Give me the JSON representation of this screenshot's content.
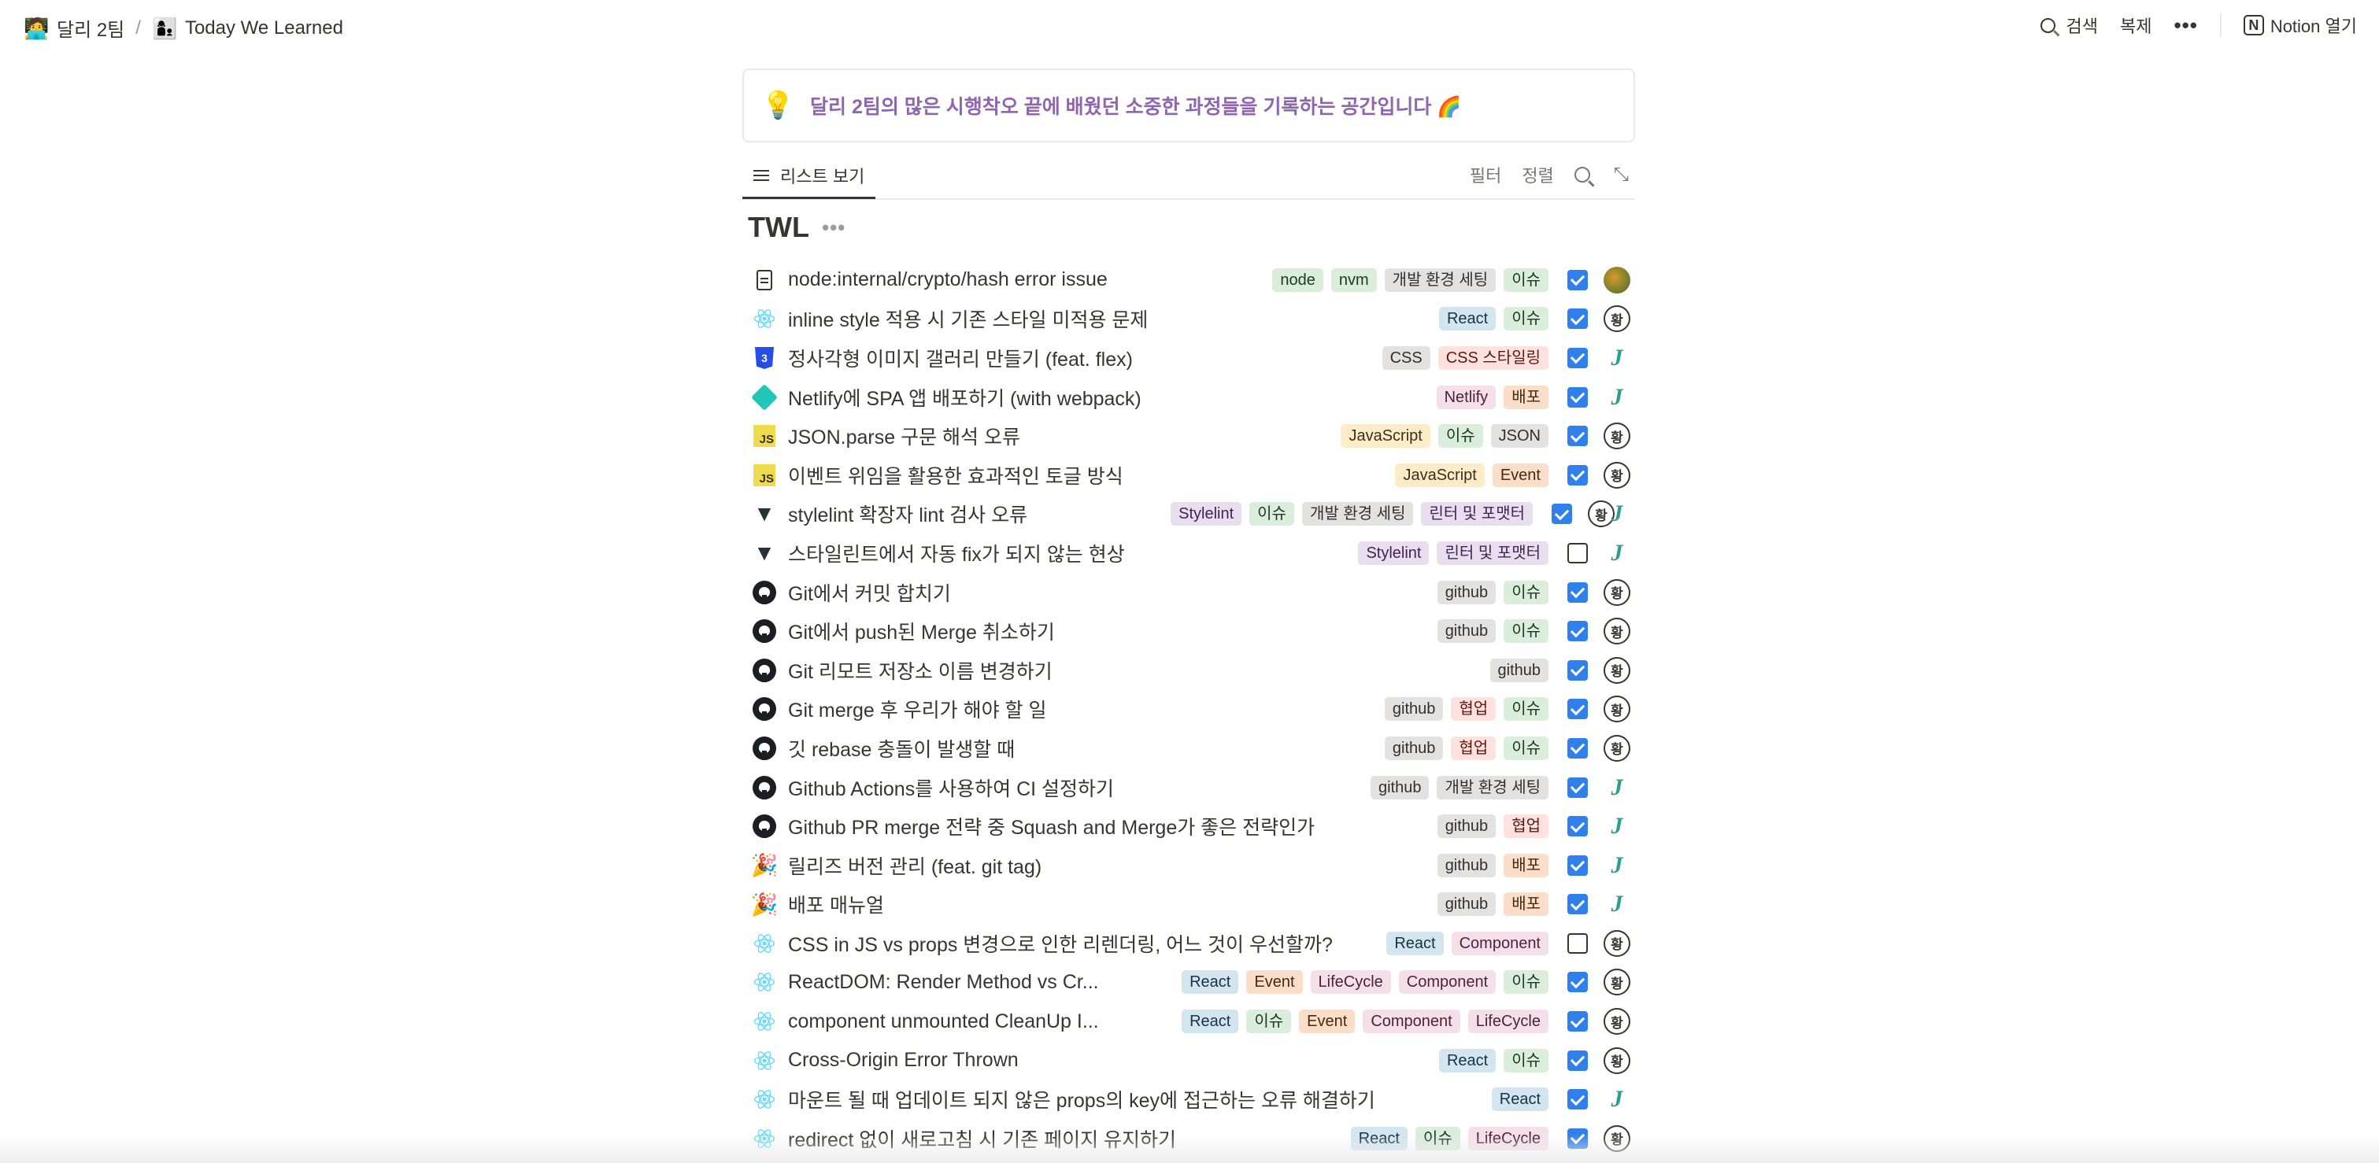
{
  "breadcrumb": {
    "items": [
      {
        "icon": "developer-emoji",
        "label": "달리 2팀"
      },
      {
        "icon": "people-emoji",
        "label": "Today We Learned"
      }
    ],
    "separator": "/"
  },
  "topbar": {
    "search_label": "검색",
    "duplicate_label": "복제",
    "more_label": "•••",
    "open_notion_label": "Notion 열기"
  },
  "callout": {
    "icon": "lightbulb-emoji",
    "text": "달리 2팀의 많은 시행착오 끝에 배웠던 소중한 과정들을 기록하는 공간입니다 🌈",
    "color": "#9065b0"
  },
  "view": {
    "tab_label": "리스트 보기",
    "filter_label": "필터",
    "sort_label": "정렬"
  },
  "database": {
    "title": "TWL",
    "more_label": "•••"
  },
  "colors": {
    "checkbox_checked": "#2f80ed",
    "tag_bg": {
      "gray": "#e3e2e0",
      "green": "#dbeddb",
      "blue": "#d3e5ef",
      "red": "#ffe2dd",
      "pink": "#f5e0e9",
      "orange": "#fadec9",
      "yellow": "#fdecc8",
      "purple": "#e8deee"
    },
    "tag_fg": {
      "gray": "#32302c",
      "green": "#1c3829",
      "blue": "#183347",
      "red": "#5d1715",
      "pink": "#4c2337",
      "orange": "#49290e",
      "yellow": "#402c1b",
      "purple": "#412454"
    }
  },
  "rows": [
    {
      "icon": "document-icon",
      "title": "node:internal/crypto/hash error issue",
      "tags": [
        {
          "label": "node",
          "color": "green"
        },
        {
          "label": "nvm",
          "color": "green"
        },
        {
          "label": "개발 환경 세팅",
          "color": "gray"
        },
        {
          "label": "이슈",
          "color": "green"
        }
      ],
      "checked": true,
      "avatar": "photo"
    },
    {
      "icon": "react-icon",
      "title": "inline style 적용 시 기존 스타일 미적용 문제",
      "tags": [
        {
          "label": "React",
          "color": "blue"
        },
        {
          "label": "이슈",
          "color": "green"
        }
      ],
      "checked": true,
      "avatar": "황"
    },
    {
      "icon": "css-icon",
      "title": "정사각형 이미지 갤러리 만들기 (feat. flex)",
      "tags": [
        {
          "label": "CSS",
          "color": "gray"
        },
        {
          "label": "CSS 스타일링",
          "color": "red"
        }
      ],
      "checked": true,
      "avatar": "J"
    },
    {
      "icon": "netlify-icon",
      "title": "Netlify에 SPA 앱 배포하기 (with webpack)",
      "tags": [
        {
          "label": "Netlify",
          "color": "pink"
        },
        {
          "label": "배포",
          "color": "orange"
        }
      ],
      "checked": true,
      "avatar": "J"
    },
    {
      "icon": "javascript-icon",
      "title": "JSON.parse 구문 해석 오류",
      "tags": [
        {
          "label": "JavaScript",
          "color": "yellow"
        },
        {
          "label": "이슈",
          "color": "green"
        },
        {
          "label": "JSON",
          "color": "gray"
        }
      ],
      "checked": true,
      "avatar": "황"
    },
    {
      "icon": "javascript-icon",
      "title": "이벤트 위임을 활용한 효과적인 토글 방식",
      "tags": [
        {
          "label": "JavaScript",
          "color": "yellow"
        },
        {
          "label": "Event",
          "color": "orange"
        }
      ],
      "checked": true,
      "avatar": "황"
    },
    {
      "icon": "stylelint-icon",
      "title": "stylelint 확장자 lint 검사 오류",
      "tags": [
        {
          "label": "Stylelint",
          "color": "purple"
        },
        {
          "label": "이슈",
          "color": "green"
        },
        {
          "label": "개발 환경 세팅",
          "color": "gray"
        },
        {
          "label": "린터 및 포맷터",
          "color": "purple"
        }
      ],
      "checked": true,
      "avatar": "황J"
    },
    {
      "icon": "stylelint-icon",
      "title": "스타일린트에서 자동 fix가 되지 않는 현상",
      "tags": [
        {
          "label": "Stylelint",
          "color": "purple"
        },
        {
          "label": "린터 및 포맷터",
          "color": "purple"
        }
      ],
      "checked": false,
      "avatar": "J"
    },
    {
      "icon": "github-icon",
      "title": "Git에서 커밋 합치기",
      "tags": [
        {
          "label": "github",
          "color": "gray"
        },
        {
          "label": "이슈",
          "color": "green"
        }
      ],
      "checked": true,
      "avatar": "황"
    },
    {
      "icon": "github-icon",
      "title": "Git에서 push된 Merge 취소하기",
      "tags": [
        {
          "label": "github",
          "color": "gray"
        },
        {
          "label": "이슈",
          "color": "green"
        }
      ],
      "checked": true,
      "avatar": "황"
    },
    {
      "icon": "github-icon",
      "title": "Git 리모트 저장소 이름 변경하기",
      "tags": [
        {
          "label": "github",
          "color": "gray"
        }
      ],
      "checked": true,
      "avatar": "황"
    },
    {
      "icon": "github-icon",
      "title": "Git merge 후 우리가 해야 할 일",
      "tags": [
        {
          "label": "github",
          "color": "gray"
        },
        {
          "label": "협업",
          "color": "red"
        },
        {
          "label": "이슈",
          "color": "green"
        }
      ],
      "checked": true,
      "avatar": "황"
    },
    {
      "icon": "github-icon",
      "title": "깃 rebase 충돌이 발생할 때",
      "tags": [
        {
          "label": "github",
          "color": "gray"
        },
        {
          "label": "협업",
          "color": "red"
        },
        {
          "label": "이슈",
          "color": "green"
        }
      ],
      "checked": true,
      "avatar": "황"
    },
    {
      "icon": "github-icon",
      "title": "Github Actions를 사용하여 CI 설정하기",
      "tags": [
        {
          "label": "github",
          "color": "gray"
        },
        {
          "label": "개발 환경 세팅",
          "color": "gray"
        }
      ],
      "checked": true,
      "avatar": "J"
    },
    {
      "icon": "github-icon",
      "title": "Github PR merge 전략 중 Squash and Merge가 좋은 전략인가",
      "tags": [
        {
          "label": "github",
          "color": "gray"
        },
        {
          "label": "협업",
          "color": "red"
        }
      ],
      "checked": true,
      "avatar": "J"
    },
    {
      "icon": "party-popper-icon",
      "title": "릴리즈 버전 관리 (feat. git tag)",
      "tags": [
        {
          "label": "github",
          "color": "gray"
        },
        {
          "label": "배포",
          "color": "orange"
        }
      ],
      "checked": true,
      "avatar": "J"
    },
    {
      "icon": "party-popper-icon",
      "title": "배포 매뉴얼",
      "tags": [
        {
          "label": "github",
          "color": "gray"
        },
        {
          "label": "배포",
          "color": "orange"
        }
      ],
      "checked": true,
      "avatar": "J"
    },
    {
      "icon": "react-icon",
      "title": "CSS in JS vs props 변경으로 인한 리렌더링, 어느 것이 우선할까?",
      "tags": [
        {
          "label": "React",
          "color": "blue"
        },
        {
          "label": "Component",
          "color": "pink"
        }
      ],
      "checked": false,
      "avatar": "황"
    },
    {
      "icon": "react-icon",
      "title": "ReactDOM: Render Method vs Cr...",
      "tags": [
        {
          "label": "React",
          "color": "blue"
        },
        {
          "label": "Event",
          "color": "orange"
        },
        {
          "label": "LifeCycle",
          "color": "pink"
        },
        {
          "label": "Component",
          "color": "pink"
        },
        {
          "label": "이슈",
          "color": "green"
        }
      ],
      "checked": true,
      "avatar": "황"
    },
    {
      "icon": "react-icon",
      "title": "component unmounted CleanUp I...",
      "tags": [
        {
          "label": "React",
          "color": "blue"
        },
        {
          "label": "이슈",
          "color": "green"
        },
        {
          "label": "Event",
          "color": "orange"
        },
        {
          "label": "Component",
          "color": "pink"
        },
        {
          "label": "LifeCycle",
          "color": "pink"
        }
      ],
      "checked": true,
      "avatar": "황"
    },
    {
      "icon": "react-icon",
      "title": "Cross-Origin Error Thrown",
      "tags": [
        {
          "label": "React",
          "color": "blue"
        },
        {
          "label": "이슈",
          "color": "green"
        }
      ],
      "checked": true,
      "avatar": "황"
    },
    {
      "icon": "react-icon",
      "title": "마운트 될 때 업데이트 되지 않은 props의 key에 접근하는 오류 해결하기",
      "tags": [
        {
          "label": "React",
          "color": "blue"
        }
      ],
      "checked": true,
      "avatar": "J"
    },
    {
      "icon": "react-icon",
      "title": "redirect 없이 새로고침 시 기존 페이지 유지하기",
      "tags": [
        {
          "label": "React",
          "color": "blue"
        },
        {
          "label": "이슈",
          "color": "green"
        },
        {
          "label": "LifeCycle",
          "color": "pink"
        }
      ],
      "checked": true,
      "avatar": "황"
    }
  ]
}
